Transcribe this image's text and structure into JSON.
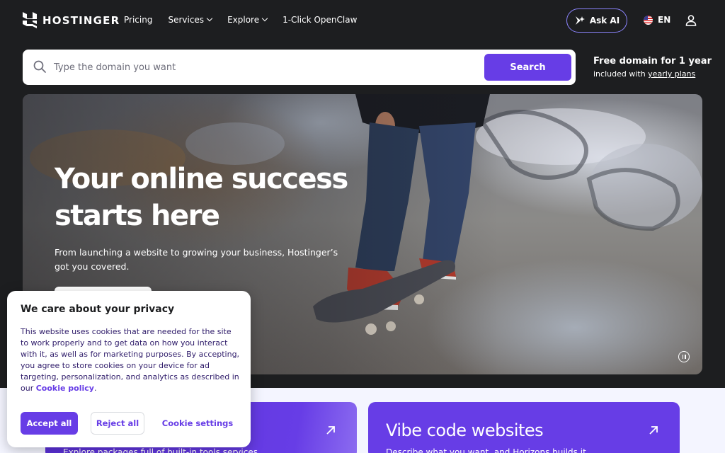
{
  "nav": {
    "logo_text": "HOSTINGER",
    "links": [
      {
        "label": "Pricing",
        "dropdown": false
      },
      {
        "label": "Services",
        "dropdown": true
      },
      {
        "label": "Explore",
        "dropdown": true
      },
      {
        "label": "1-Click OpenClaw",
        "dropdown": false
      }
    ],
    "ask_ai_label": "Ask AI",
    "language": "EN"
  },
  "search": {
    "placeholder": "Type the domain you want",
    "button_label": "Search",
    "promo_title": "Free domain for 1 year",
    "promo_prefix": "included with ",
    "promo_link": "yearly plans"
  },
  "hero": {
    "title": "Your online success starts here",
    "subtitle": "From launching a website to growing your business, Hostinger’s got you covered."
  },
  "cards": [
    {
      "title": "",
      "desc": "Explore packages full of built-in tools services"
    },
    {
      "title": "Vibe code websites",
      "desc": "Describe what you want, and Horizons builds it"
    }
  ],
  "cookie": {
    "title": "We care about your privacy",
    "text": "This website uses cookies that are needed for the site to work properly and to get data on how you interact with it, as well as for marketing purposes. By accepting, you agree to store cookies on your device for ad targeting, personalization, and analytics as described in our ",
    "link": "Cookie policy",
    "link_suffix": ".",
    "accept_label": "Accept all",
    "reject_label": "Reject all",
    "settings_label": "Cookie settings"
  },
  "colors": {
    "brand": "#673de6",
    "nav_bg": "#1d1e20",
    "ask_ai_border": "#8c85ff"
  }
}
